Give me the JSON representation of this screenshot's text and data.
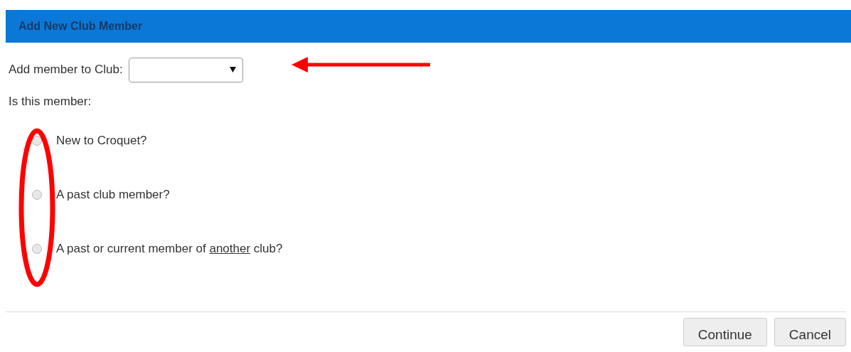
{
  "dialog": {
    "title": "Add New Club Member"
  },
  "club_field": {
    "label": "Add member to Club:"
  },
  "question": "Is this member:",
  "options": [
    {
      "label_parts": [
        {
          "text": "New to Croquet?",
          "underline": false
        }
      ],
      "selected": false
    },
    {
      "label_parts": [
        {
          "text": "A past club member?",
          "underline": false
        }
      ],
      "selected": false
    },
    {
      "label_parts": [
        {
          "text": "A past or current member of ",
          "underline": false
        },
        {
          "text": "another",
          "underline": true
        },
        {
          "text": " club?",
          "underline": false
        }
      ],
      "selected": false
    }
  ],
  "buttons": [
    {
      "label": "Continue"
    },
    {
      "label": "Cancel"
    }
  ]
}
